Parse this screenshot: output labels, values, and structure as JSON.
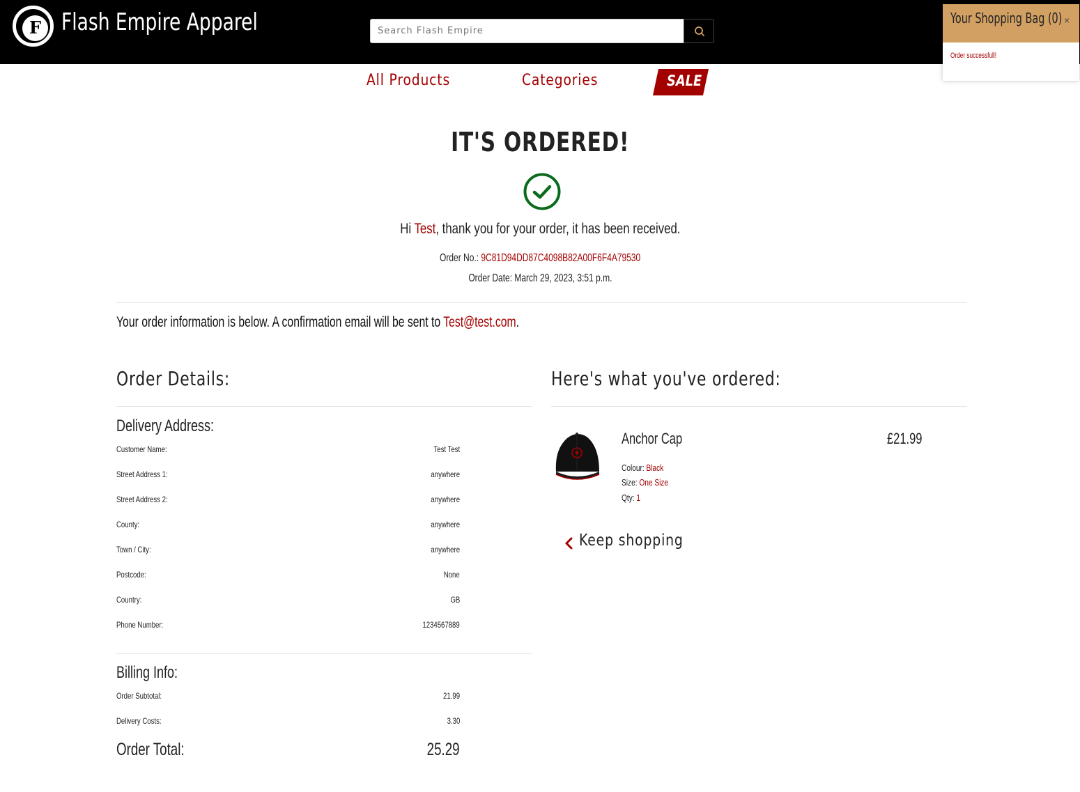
{
  "header": {
    "logo_letter": "F",
    "logo_ring_text": "FLASH EMPIRE APPAREL",
    "brand": "Flash Empire Apparel",
    "search_placeholder": "Search Flash Empire",
    "search_icon": "search-icon"
  },
  "bag": {
    "title": "Your Shopping Bag (0)",
    "close": "×",
    "message": "Order successfull!"
  },
  "nav": {
    "all_products": "All Products",
    "categories": "Categories",
    "sale": "SALE"
  },
  "confirmation": {
    "headline": "IT'S ORDERED!",
    "check_icon": "check-circle-icon",
    "greeting_prefix": "Hi ",
    "customer_first_name": "Test",
    "greeting_suffix": ", thank you for your order, it has been received.",
    "order_no_label": "Order No.: ",
    "order_no": "9C81D94DD87C4098B82A00F6F4A79530",
    "order_date_label": "Order Date: ",
    "order_date": "March 29, 2023, 3:51 p.m.",
    "info_prefix": "Your order information is below. A confirmation email will be sent to ",
    "email": "Test@test.com",
    "info_suffix": "."
  },
  "order_details": {
    "title": "Order Details:",
    "delivery_title": "Delivery Address:",
    "delivery_rows": [
      {
        "label": "Customer Name:",
        "value": "Test Test"
      },
      {
        "label": "Street Address 1:",
        "value": "anywhere"
      },
      {
        "label": "Street Address 2:",
        "value": "anywhere"
      },
      {
        "label": "County:",
        "value": "anywhere"
      },
      {
        "label": "Town / City:",
        "value": "anywhere"
      },
      {
        "label": "Postcode:",
        "value": "None"
      },
      {
        "label": "Country:",
        "value": "GB"
      },
      {
        "label": "Phone Number:",
        "value": "1234567889"
      }
    ],
    "billing_title": "Billing Info:",
    "billing_rows": [
      {
        "label": "Order Subtotal:",
        "value": "21.99"
      },
      {
        "label": "Delivery Costs:",
        "value": "3.30"
      }
    ],
    "total_label": "Order Total:",
    "total_value": "25.29"
  },
  "ordered": {
    "title": "Here's what you've ordered:",
    "items": [
      {
        "name": "Anchor Cap",
        "price": "£21.99",
        "colour_label": "Colour: ",
        "colour": "Black",
        "size_label": "Size: ",
        "size": "One Size",
        "qty_label": "Qty: ",
        "qty": "1",
        "image_icon": "cap-image"
      }
    ],
    "keep_shopping": "Keep shopping",
    "keep_icon": "chevron-left-icon"
  },
  "colors": {
    "accent": "#a30000",
    "header_bg": "#000000",
    "bag_header": "#d2a063",
    "success": "#0b6b1c"
  }
}
